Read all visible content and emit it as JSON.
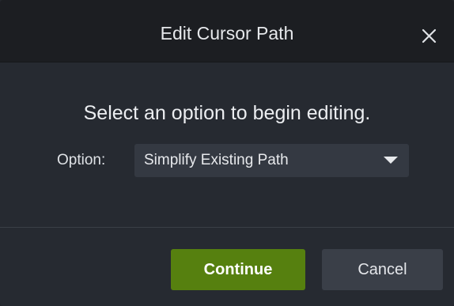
{
  "dialog": {
    "title": "Edit Cursor Path",
    "close_icon": "close-icon",
    "prompt": "Select an option to begin editing.",
    "option_label": "Option:",
    "option_selected": "Simplify Existing Path",
    "dropdown_icon": "chevron-down-icon",
    "continue_label": "Continue",
    "cancel_label": "Cancel"
  },
  "colors": {
    "titlebar": "#1c1e22",
    "background": "#262a31",
    "select_bg": "#343942",
    "continue_bg": "#56800f",
    "cancel_bg": "#3a3f48"
  }
}
